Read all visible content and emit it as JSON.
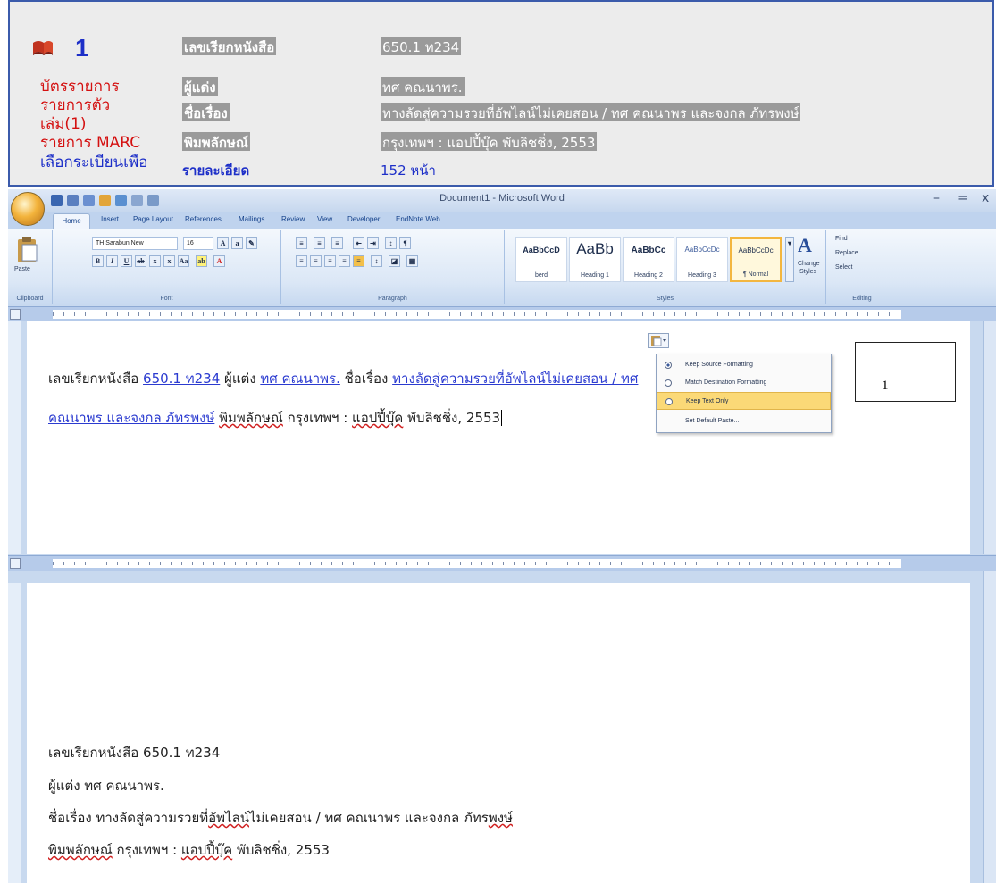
{
  "catalog": {
    "record_number": "1",
    "side_links": [
      "บัตรรายการ",
      "รายการตัว",
      "เล่ม(1)",
      "รายการ MARC",
      "เลือกระเบียนเพื่อ"
    ],
    "fields": [
      {
        "label": "เลขเรียกหนังสือ",
        "value": "650.1 ท234"
      },
      {
        "label": "ผู้แต่ง",
        "value": "ทศ คณนาพร."
      },
      {
        "label": "ชื่อเรื่อง",
        "value": "ทางลัดสู่ความรวยที่อัพไลน์ไม่เคยสอน / ทศ คณนาพร และจงกล ภัทรพงษ์"
      },
      {
        "label": "พิมพลักษณ์",
        "value": "กรุงเทพฯ : แอปปี้บุ๊ค พับลิชชิ่ง, 2553"
      },
      {
        "label": "รายละเอียด",
        "value": "152 หน้า"
      }
    ]
  },
  "word": {
    "title": "Document1 - Microsoft Word",
    "window_controls": [
      "–",
      "=",
      "x"
    ],
    "tabs": [
      "Home",
      "Insert",
      "Page Layout",
      "References",
      "Mailings",
      "Review",
      "View",
      "Developer",
      "EndNote Web"
    ],
    "ribbon": {
      "clipboard": {
        "paste": "Paste",
        "label": "Clipboard"
      },
      "font": {
        "name": "TH Sarabun New",
        "size": "16",
        "label": "Font"
      },
      "paragraph": {
        "label": "Paragraph"
      },
      "styles": {
        "label": "Styles",
        "items": [
          {
            "preview": "AaBbCcD",
            "name": "berd"
          },
          {
            "preview": "AaBb",
            "name": "Heading 1"
          },
          {
            "preview": "AaBbCc",
            "name": "Heading 2"
          },
          {
            "preview": "AaBbCcDc",
            "name": "Heading 3"
          },
          {
            "preview": "AaBbCcDc",
            "name": "¶ Normal"
          }
        ],
        "change_styles": [
          "Change",
          "Styles"
        ]
      },
      "editing": {
        "label": "Editing",
        "find": "Find",
        "replace": "Replace",
        "select": "Select"
      }
    },
    "doc1": {
      "line1": {
        "t1": "เลขเรียกหนังสือ ",
        "t2": "650.1 ท234",
        "t3": " ผู้แต่ง ",
        "t4": "ทศ คณนาพร.",
        "t5": " ชื่อเรื่อง ",
        "t6": "ทางลัดสู่ความรวยที่อัพไลน์ไม่เคยสอน / ทศ"
      },
      "line2": {
        "t1": "คณนาพร และจงกล ภัทรพงษ์",
        "t2": " ",
        "t3": "พิมพลักษณ์",
        "t4": " กรุงเทพฯ : ",
        "t5": "แอปปี้บุ๊ค",
        "t6": " พับลิชชิ่ง, 2553"
      }
    },
    "paste_options": [
      "Keep Source Formatting",
      "Match Destination Formatting",
      "Keep Text Only",
      "Set Default Paste..."
    ],
    "textbox": "1",
    "doc2": {
      "line1": {
        "t1": "เลขเรียกหนังสือ 650.1 ท234"
      },
      "line2": {
        "t1": "ผู้แต่ง   ทศ คณนาพร."
      },
      "line3": {
        "t1": "ชื่อเรื่อง ทางลัดสู่ความรวยที่",
        "t2": "อัพไลน์",
        "t3": "ไม่เคยสอน / ทศ คณนาพร และจงกล ภัทร",
        "t4": "พงษ์"
      },
      "line4": {
        "t1": "พิมพลักษณ์",
        "t2": " กรุงเทพฯ : ",
        "t3": "แอปปี้บุ๊ค",
        "t4": " พับลิชชิ่ง, 2553"
      }
    }
  }
}
